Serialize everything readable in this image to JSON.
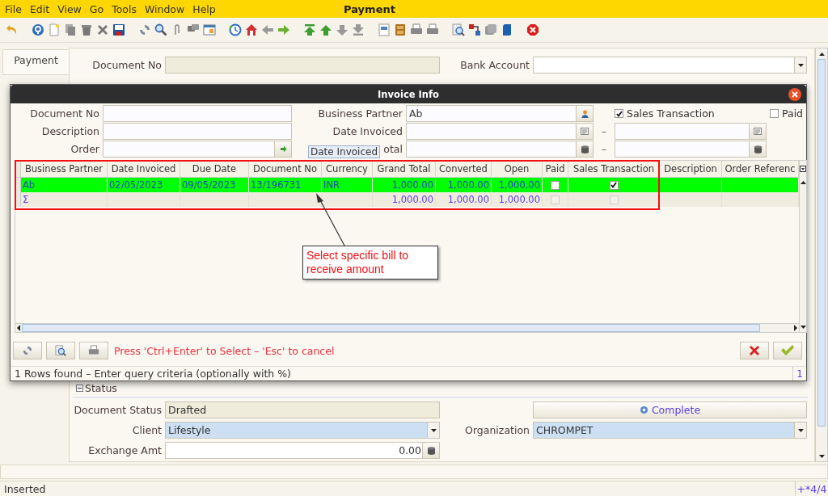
{
  "window": {
    "title": "Payment"
  },
  "menu": [
    "File",
    "Edit",
    "View",
    "Go",
    "Tools",
    "Window",
    "Help"
  ],
  "side_tabs": [
    {
      "label": "Payment",
      "selected": true
    }
  ],
  "header_fields": [
    {
      "label": "Document No",
      "kind": "readonly"
    },
    {
      "label": "Bank Account",
      "kind": "dropdown"
    }
  ],
  "status_section": {
    "title": "Status",
    "expanded": true
  },
  "status_fields": [
    {
      "label": "Document Status",
      "kind": "readonly",
      "value": "Drafted"
    },
    {
      "kind": "button",
      "label": "Complete"
    },
    {
      "label": "Client",
      "kind": "dropdown",
      "value": "Lifestyle"
    },
    {
      "label": "Organization",
      "kind": "dropdown",
      "value": "CHROMPET"
    },
    {
      "label": "Exchange Amt",
      "kind": "number",
      "value": "0.00"
    }
  ],
  "dialog": {
    "title": "Invoice Info",
    "filters": {
      "document_no": {
        "label": "Document No"
      },
      "description": {
        "label": "Description"
      },
      "order": {
        "label": "Order"
      },
      "business_partner": {
        "label": "Business Partner",
        "value": "Ab"
      },
      "date_invoiced": {
        "label": "Date Invoiced",
        "separator": "–"
      },
      "total": {
        "label": "otal",
        "separator": "–"
      },
      "sales_transaction": {
        "label": "Sales Transaction",
        "checked": true
      },
      "paid": {
        "label": "Paid",
        "checked": false
      }
    },
    "tooltip": "Date Invoiced",
    "table": {
      "columns": [
        {
          "label": "Business Partner",
          "kind": "text"
        },
        {
          "label": "Date Invoiced",
          "kind": "text"
        },
        {
          "label": "Due Date",
          "kind": "text"
        },
        {
          "label": "Document No",
          "kind": "text"
        },
        {
          "label": "Currency",
          "kind": "text"
        },
        {
          "label": "Grand Total",
          "kind": "number"
        },
        {
          "label": "Converted",
          "kind": "number"
        },
        {
          "label": "Open",
          "kind": "number"
        },
        {
          "label": "Paid",
          "kind": "check"
        },
        {
          "label": "Sales Transaction",
          "kind": "check"
        },
        {
          "label": "Description",
          "kind": "text"
        },
        {
          "label": "Order Referenc",
          "kind": "text"
        }
      ],
      "rows": [
        {
          "selected": true,
          "cells": [
            "Ab",
            "02/05/2023",
            "09/05/2023",
            "13/196731",
            "INR",
            "1,000.00",
            "1,000.00",
            "1,000.00"
          ],
          "paid": false,
          "sales_transaction": true
        }
      ],
      "sum_row": {
        "label": "Σ",
        "cells": [
          "1,000.00",
          "1,000.00",
          "1,000.00"
        ],
        "paid": false,
        "sales_transaction": false
      }
    },
    "hint": "Press 'Ctrl+Enter' to Select – 'Esc' to cancel",
    "status": "1 Rows found – Enter query criteria (optionally with %)",
    "count": "1"
  },
  "annotation": {
    "text": "Select specific bill to receive amount"
  },
  "status_bar": {
    "message": "Inserted",
    "record": "+*4/4"
  }
}
